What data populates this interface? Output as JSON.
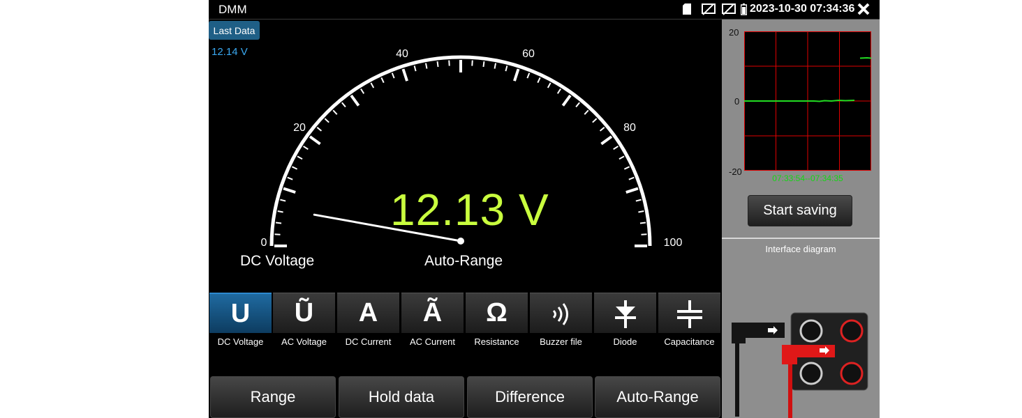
{
  "status_bar": {
    "app_title": "DMM",
    "icons": [
      "sd-card-icon",
      "screen-off-icon",
      "screen-off-icon",
      "battery-icon",
      "close-icon"
    ],
    "datetime": "2023-10-30 07:34:36"
  },
  "gauge": {
    "last_data_button": "Last Data",
    "last_data_value": "12.14  V",
    "scale_labels": [
      "0",
      "20",
      "40",
      "60",
      "80",
      "100"
    ],
    "reading": "12.13  V",
    "reading_value": 12.13,
    "scale_max": 100,
    "mode": "DC Voltage",
    "range_mode": "Auto-Range",
    "reading_color": "#c9ff3e"
  },
  "modes": [
    {
      "symbol": "U",
      "label": "DC Voltage",
      "active": true
    },
    {
      "symbol": "Ũ",
      "label": "AC Voltage",
      "active": false
    },
    {
      "symbol": "A",
      "label": "DC Current",
      "active": false
    },
    {
      "symbol": "Ã",
      "label": "AC Current",
      "active": false
    },
    {
      "symbol": "Ω",
      "label": "Resistance",
      "active": false
    },
    {
      "symbol": "🔊",
      "label": "Buzzer file",
      "active": false
    },
    {
      "symbol": "⏬",
      "label": "Diode",
      "active": false
    },
    {
      "symbol": "╪",
      "label": "Capacitance",
      "active": false
    }
  ],
  "bottom_buttons": [
    "Range",
    "Hold data",
    "Difference",
    "Auto-Range"
  ],
  "trend": {
    "y_ticks": [
      "20",
      "0",
      "-20"
    ],
    "time_range": "07:33:54--07:34:35",
    "button": "Start saving",
    "grid_color": "#e00000",
    "line_color": "#22dd22"
  },
  "diagram": {
    "title": "Interface diagram"
  }
}
